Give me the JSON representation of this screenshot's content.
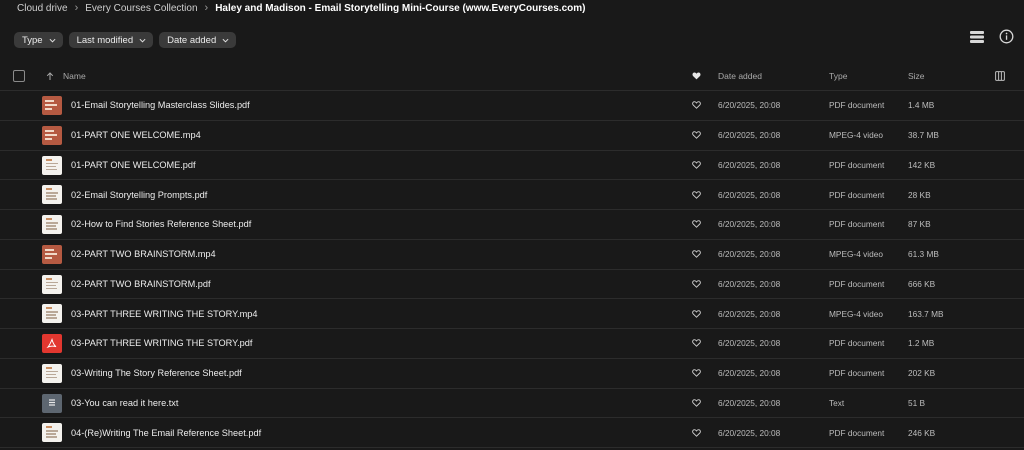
{
  "breadcrumb": [
    "Cloud drive",
    "Every Courses Collection",
    "Haley and Madison - Email Storytelling Mini-Course (www.EveryCourses.com)"
  ],
  "filters": {
    "type": "Type",
    "last_modified": "Last modified",
    "date_added": "Date added"
  },
  "icons": {
    "view_toggle": "list-view-icon",
    "info": "info-icon",
    "sort": "arrow-up-icon",
    "favourite": "heart-icon",
    "columns": "columns-icon"
  },
  "table": {
    "headers": {
      "name": "Name",
      "date_added": "Date added",
      "type": "Type",
      "size": "Size"
    },
    "rows": [
      {
        "name": "01-Email Storytelling Masterclass Slides.pdf",
        "date": "6/20/2025, 20:08",
        "type": "PDF document",
        "size": "1.4 MB",
        "thumb": "slide"
      },
      {
        "name": "01-PART ONE WELCOME.mp4",
        "date": "6/20/2025, 20:08",
        "type": "MPEG-4 video",
        "size": "38.7 MB",
        "thumb": "slide"
      },
      {
        "name": "01-PART ONE WELCOME.pdf",
        "date": "6/20/2025, 20:08",
        "type": "PDF document",
        "size": "142 KB",
        "thumb": "doc"
      },
      {
        "name": "02-Email Storytelling Prompts.pdf",
        "date": "6/20/2025, 20:08",
        "type": "PDF document",
        "size": "28 KB",
        "thumb": "doc"
      },
      {
        "name": "02-How to Find Stories Reference Sheet.pdf",
        "date": "6/20/2025, 20:08",
        "type": "PDF document",
        "size": "87 KB",
        "thumb": "doc"
      },
      {
        "name": "02-PART TWO BRAINSTORM.mp4",
        "date": "6/20/2025, 20:08",
        "type": "MPEG-4 video",
        "size": "61.3 MB",
        "thumb": "slide"
      },
      {
        "name": "02-PART TWO BRAINSTORM.pdf",
        "date": "6/20/2025, 20:08",
        "type": "PDF document",
        "size": "666 KB",
        "thumb": "doc"
      },
      {
        "name": "03-PART THREE WRITING THE STORY.mp4",
        "date": "6/20/2025, 20:08",
        "type": "MPEG-4 video",
        "size": "163.7 MB",
        "thumb": "doc"
      },
      {
        "name": "03-PART THREE WRITING THE STORY.pdf",
        "date": "6/20/2025, 20:08",
        "type": "PDF document",
        "size": "1.2 MB",
        "thumb": "pdf"
      },
      {
        "name": "03-Writing The Story Reference Sheet.pdf",
        "date": "6/20/2025, 20:08",
        "type": "PDF document",
        "size": "202 KB",
        "thumb": "doc"
      },
      {
        "name": "03-You can read it here.txt",
        "date": "6/20/2025, 20:08",
        "type": "Text",
        "size": "51 B",
        "thumb": "txt"
      },
      {
        "name": "04-(Re)Writing The Email Reference Sheet.pdf",
        "date": "6/20/2025, 20:08",
        "type": "PDF document",
        "size": "246 KB",
        "thumb": "doc"
      }
    ]
  }
}
